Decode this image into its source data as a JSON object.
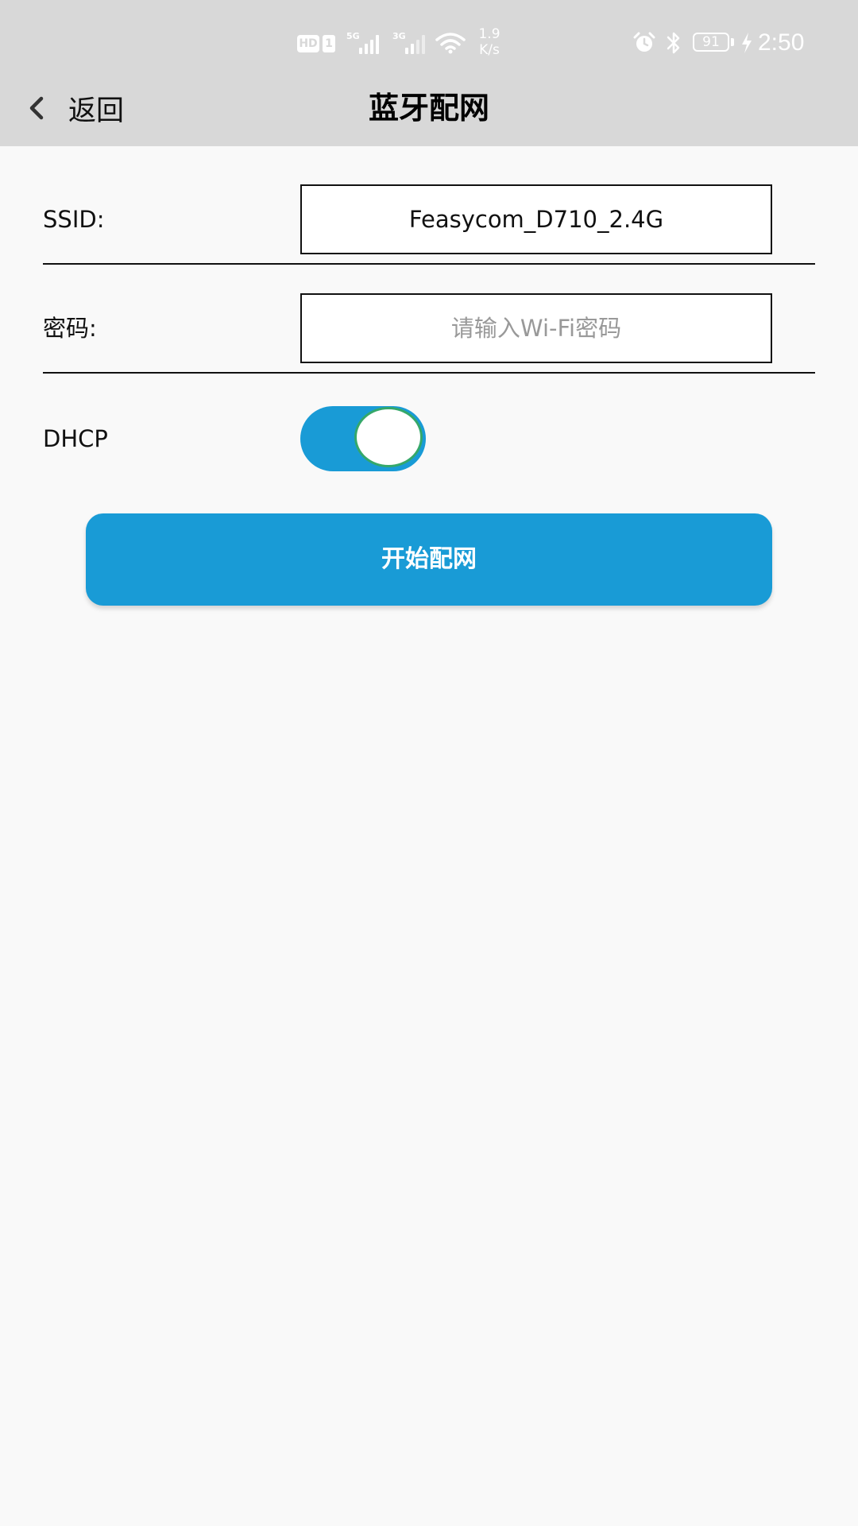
{
  "status_bar": {
    "hd_badge": "HD",
    "sim_badge": "1",
    "network_1": "5G",
    "network_2": "3G",
    "speed_value": "1.9",
    "speed_unit": "K/s",
    "battery_level": "91",
    "time": "2:50",
    "icons": [
      "hd-icon",
      "sim-1-icon",
      "signal-5g-icon",
      "signal-3g-icon",
      "wifi-icon",
      "alarm-icon",
      "bluetooth-icon",
      "battery-icon",
      "charging-icon"
    ]
  },
  "header": {
    "back_label": "返回",
    "title": "蓝牙配网",
    "background": "#d8d8d8"
  },
  "form": {
    "ssid_label": "SSID:",
    "ssid_value": "Feasycom_D710_2.4G",
    "password_label": "密码:",
    "password_value": "",
    "password_placeholder": "请输入Wi-Fi密码",
    "dhcp_label": "DHCP",
    "dhcp_enabled": true
  },
  "actions": {
    "start_button_label": "开始配网"
  },
  "colors": {
    "accent": "#199bd6",
    "toggle_knob_border": "#35a86a",
    "page_background": "#f9f9f9"
  }
}
